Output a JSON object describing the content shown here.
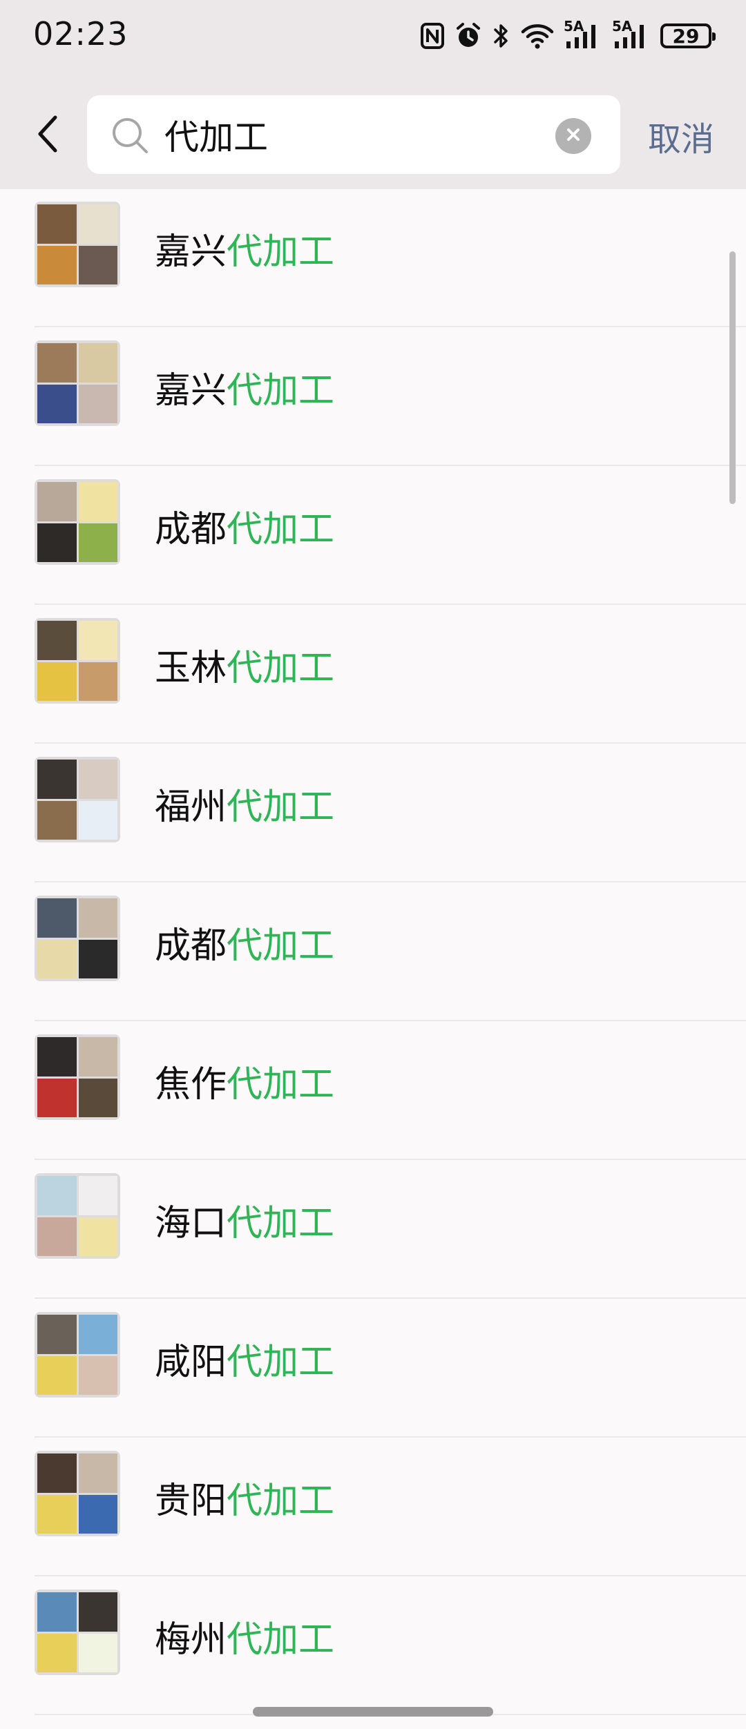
{
  "status_bar": {
    "time": "02:23",
    "network_label_1": "5A",
    "network_label_2": "5A",
    "battery": "29",
    "icons": [
      "nfc-icon",
      "alarm-icon",
      "bluetooth-icon",
      "wifi-icon",
      "signal-icon",
      "signal-icon",
      "battery-icon"
    ]
  },
  "search": {
    "query": "代加工",
    "cancel_label": "取消",
    "icons": [
      "back-arrow-icon",
      "search-icon",
      "clear-icon"
    ]
  },
  "colors": {
    "highlight": "#2fb456",
    "cancel": "#5a6c8f",
    "background": "#fcf9fa",
    "header": "#ece8e9"
  },
  "results": [
    {
      "prefix": "嘉兴",
      "match": "代加工"
    },
    {
      "prefix": "嘉兴",
      "match": "代加工"
    },
    {
      "prefix": "成都",
      "match": "代加工"
    },
    {
      "prefix": "玉林",
      "match": "代加工"
    },
    {
      "prefix": "福州",
      "match": "代加工"
    },
    {
      "prefix": "成都",
      "match": "代加工"
    },
    {
      "prefix": "焦作",
      "match": "代加工"
    },
    {
      "prefix": "海口",
      "match": "代加工"
    },
    {
      "prefix": "咸阳",
      "match": "代加工"
    },
    {
      "prefix": "贵阳",
      "match": "代加工"
    },
    {
      "prefix": "梅州",
      "match": "代加工"
    }
  ]
}
